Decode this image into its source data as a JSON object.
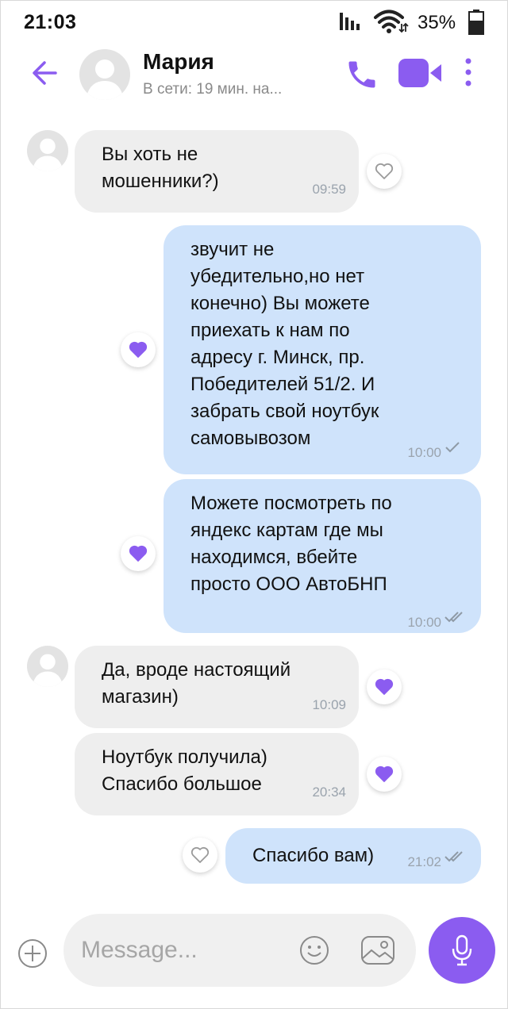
{
  "status_bar": {
    "time": "21:03",
    "battery": "35%"
  },
  "header": {
    "name": "Мария",
    "status": "В сети: 19 мин. на..."
  },
  "colors": {
    "accent": "#8b5cf0",
    "incoming": "#eeeeee",
    "outgoing": "#cfe3fb"
  },
  "messages": [
    {
      "dir": "in",
      "lines": [
        "Вы хоть не",
        "мошенники?)"
      ],
      "time": "09:59",
      "reaction": "none"
    },
    {
      "dir": "out",
      "lines": [
        "звучит не",
        "убедительно,но нет",
        "конечно) Вы можете",
        "приехать к нам по",
        "адресу г. Минск, пр.",
        "Победителей 51/2. И",
        "забрать свой ноутбук",
        "самовывозом"
      ],
      "time": "10:00",
      "reaction": "heart",
      "status": "sent"
    },
    {
      "dir": "out",
      "lines": [
        "Можете посмотреть по",
        "яндекс картам где мы",
        "находимся, вбейте",
        "просто ООО АвтоБНП"
      ],
      "time": "10:00",
      "reaction": "heart",
      "status": "read"
    },
    {
      "dir": "in",
      "lines": [
        "Да, вроде настоящий",
        "магазин)"
      ],
      "time": "10:09",
      "reaction": "heart"
    },
    {
      "dir": "in",
      "lines": [
        "Ноутбук получила)",
        "Спасибо большое"
      ],
      "time": "20:34",
      "reaction": "heart"
    },
    {
      "dir": "out",
      "lines": [
        "Спасибо вам)"
      ],
      "time": "21:02",
      "reaction": "none",
      "status": "read"
    }
  ],
  "composer": {
    "placeholder": "Message..."
  }
}
